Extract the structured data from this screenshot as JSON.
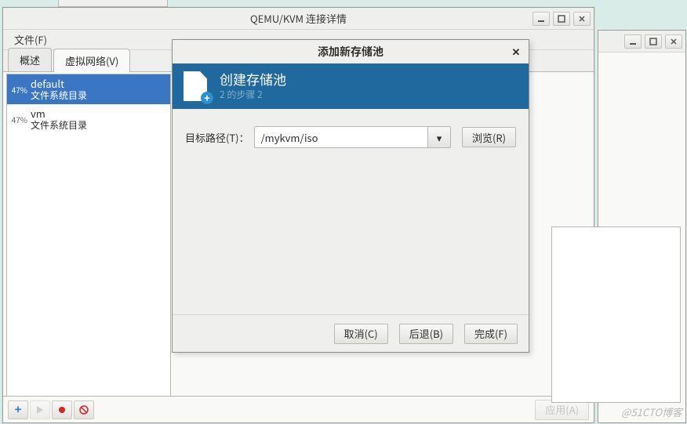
{
  "ghost_title": "",
  "main_window": {
    "title": "QEMU/KVM 连接详情",
    "menu": {
      "file": "文件(F)"
    },
    "tabs": {
      "overview": "概述",
      "vnet": "虚拟网络(V)"
    },
    "pools": [
      {
        "pct": "47%",
        "name": "default",
        "sub": "文件系统目录",
        "selected": true
      },
      {
        "pct": "47%",
        "name": "vm",
        "sub": "文件系统目录",
        "selected": false
      }
    ],
    "apply": "应用(A)"
  },
  "dialog": {
    "title": "添加新存储池",
    "header_title": "创建存储池",
    "header_sub": "2 的步骤 2",
    "target_label": "目标路径(T)：",
    "target_value": "/mykvm/iso",
    "browse": "浏览(R)",
    "cancel": "取消(C)",
    "back": "后退(B)",
    "finish": "完成(F)"
  },
  "watermark": "@51CTO博客"
}
